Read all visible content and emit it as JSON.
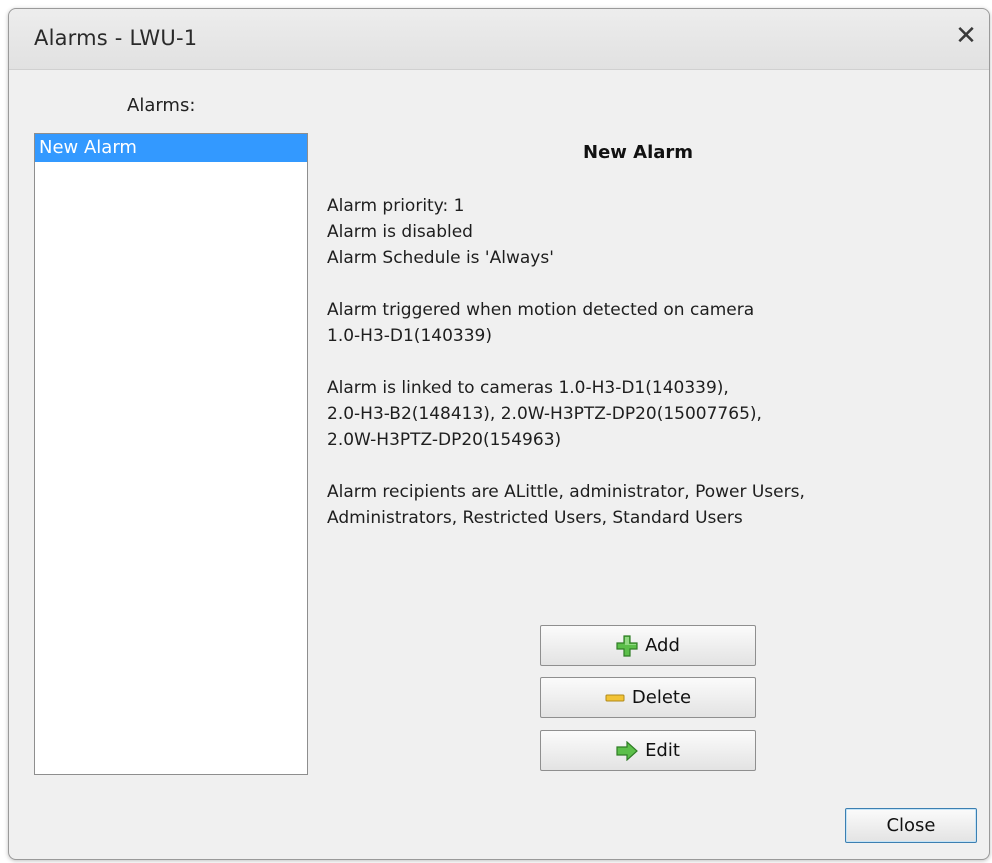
{
  "window": {
    "title": "Alarms - LWU-1",
    "close_glyph": "✕"
  },
  "alarms_panel": {
    "label": "Alarms:",
    "items": [
      {
        "label": "New Alarm",
        "selected": true
      }
    ]
  },
  "details": {
    "title": "New Alarm",
    "paragraphs": [
      [
        "Alarm priority: 1",
        "Alarm is disabled",
        "Alarm Schedule is 'Always'"
      ],
      [
        "Alarm triggered when motion detected on camera",
        "1.0-H3-D1(140339)"
      ],
      [
        "Alarm is linked to cameras 1.0-H3-D1(140339),",
        "2.0-H3-B2(148413), 2.0W-H3PTZ-DP20(15007765),",
        "2.0W-H3PTZ-DP20(154963)"
      ],
      [
        "Alarm recipients are ALittle, administrator, Power Users,",
        "Administrators, Restricted Users, Standard Users"
      ]
    ]
  },
  "buttons": {
    "add": {
      "label": "Add",
      "icon": "plus-icon"
    },
    "delete": {
      "label": "Delete",
      "icon": "minus-icon"
    },
    "edit": {
      "label": "Edit",
      "icon": "arrow-right-icon"
    },
    "close": {
      "label": "Close"
    }
  },
  "colors": {
    "selection": "#3399ff",
    "add_icon": "#4caf50",
    "delete_icon": "#f2c335",
    "edit_icon": "#4caf50"
  }
}
